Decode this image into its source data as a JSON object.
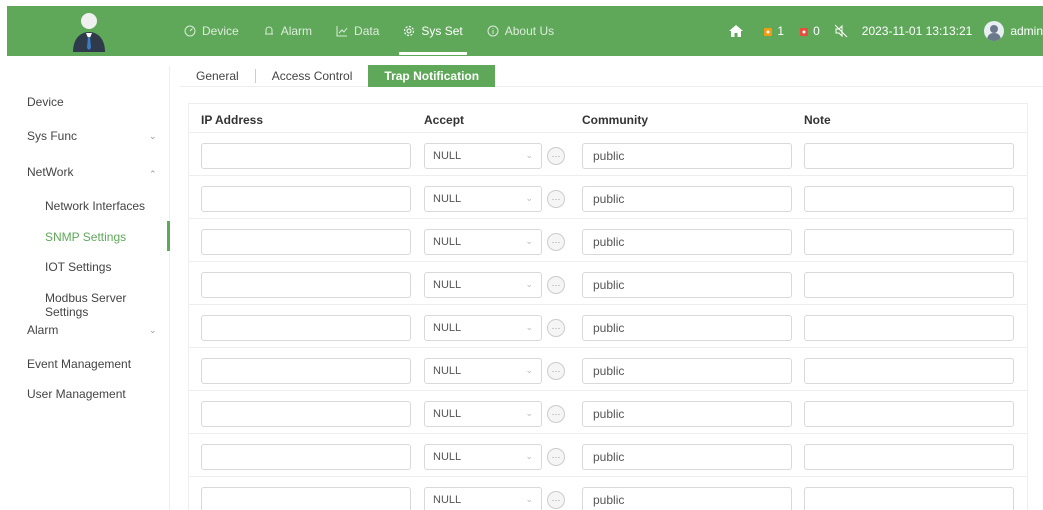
{
  "header": {
    "nav": [
      {
        "label": "Device",
        "icon": "gauge-icon"
      },
      {
        "label": "Alarm",
        "icon": "bell-icon"
      },
      {
        "label": "Data",
        "icon": "chart-icon"
      },
      {
        "label": "Sys Set",
        "icon": "gear-icon"
      },
      {
        "label": "About Us",
        "icon": "info-icon"
      }
    ],
    "alarm_count_1": "1",
    "alarm_count_2": "0",
    "datetime": "2023-11-01 13:13:21",
    "user": "admin"
  },
  "sidebar": {
    "device": "Device",
    "sys_func": "Sys Func",
    "network": "NetWork",
    "network_interfaces": "Network Interfaces",
    "snmp_settings": "SNMP Settings",
    "iot_settings": "IOT Settings",
    "modbus": "Modbus Server Settings",
    "alarm": "Alarm",
    "event_management": "Event Management",
    "user_management": "User Management"
  },
  "tabs": {
    "general": "General",
    "access_control": "Access Control",
    "trap_notification": "Trap Notification"
  },
  "table": {
    "headers": {
      "ip": "IP Address",
      "accept": "Accept",
      "community": "Community",
      "note": "Note"
    },
    "rows": [
      {
        "ip": "",
        "accept": "NULL",
        "community": "public",
        "note": ""
      },
      {
        "ip": "",
        "accept": "NULL",
        "community": "public",
        "note": ""
      },
      {
        "ip": "",
        "accept": "NULL",
        "community": "public",
        "note": ""
      },
      {
        "ip": "",
        "accept": "NULL",
        "community": "public",
        "note": ""
      },
      {
        "ip": "",
        "accept": "NULL",
        "community": "public",
        "note": ""
      },
      {
        "ip": "",
        "accept": "NULL",
        "community": "public",
        "note": ""
      },
      {
        "ip": "",
        "accept": "NULL",
        "community": "public",
        "note": ""
      },
      {
        "ip": "",
        "accept": "NULL",
        "community": "public",
        "note": ""
      },
      {
        "ip": "",
        "accept": "NULL",
        "community": "public",
        "note": ""
      }
    ]
  },
  "colors": {
    "accent": "#5fa85a"
  }
}
